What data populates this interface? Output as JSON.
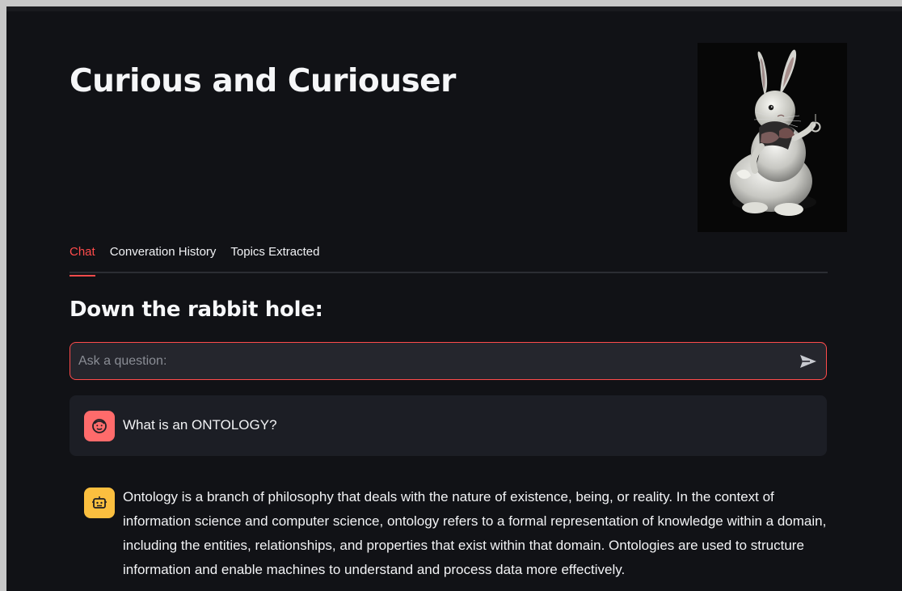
{
  "header": {
    "title": "Curious and Curiouser"
  },
  "tabs": [
    {
      "label": "Chat",
      "active": true
    },
    {
      "label": "Converation History",
      "active": false
    },
    {
      "label": "Topics Extracted",
      "active": false
    }
  ],
  "chat": {
    "heading": "Down the rabbit hole:",
    "input": {
      "placeholder": "Ask a question:",
      "value": ""
    },
    "messages": [
      {
        "role": "user",
        "avatar_icon": "smiling-face-icon",
        "text": "What is an ONTOLOGY?"
      },
      {
        "role": "assistant",
        "avatar_icon": "robot-face-icon",
        "text": "Ontology is a branch of philosophy that deals with the nature of existence, being, or reality. In the context of information science and computer science, ontology refers to a formal representation of knowledge within a domain, including the entities, relationships, and properties that exist within that domain. Ontologies are used to structure information and enable machines to understand and process data more effectively."
      }
    ]
  },
  "colors": {
    "background": "#111216",
    "accent": "#ff4b4b",
    "user_avatar": "#ff6b6b",
    "assistant_avatar": "#fbbf3f",
    "message_card": "#1c1e25",
    "input_background": "#25262d"
  },
  "icons": {
    "send": "send-arrow-icon",
    "hero_image": "white-rabbit-illustration"
  }
}
